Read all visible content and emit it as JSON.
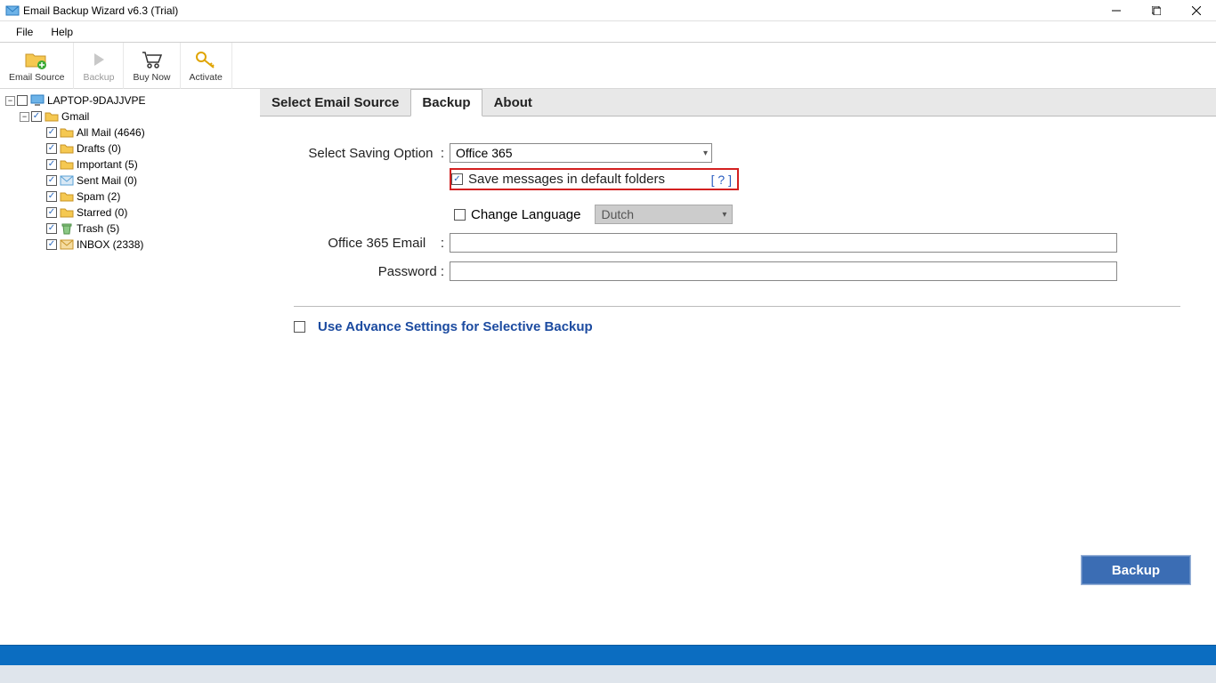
{
  "titlebar": {
    "text": "Email Backup Wizard v6.3 (Trial)"
  },
  "menubar": {
    "file": "File",
    "help": "Help"
  },
  "toolbar": {
    "email_source": "Email Source",
    "backup": "Backup",
    "buy_now": "Buy Now",
    "activate": "Activate"
  },
  "tree": {
    "root": "LAPTOP-9DAJJVPE",
    "gmail": "Gmail",
    "items": [
      "All Mail (4646)",
      "Drafts (0)",
      "Important (5)",
      "Sent Mail (0)",
      "Spam (2)",
      "Starred (0)",
      "Trash (5)",
      "INBOX (2338)"
    ]
  },
  "tabs": {
    "select_source": "Select Email Source",
    "backup": "Backup",
    "about": "About"
  },
  "form": {
    "saving_option_label": "Select Saving Option",
    "saving_option_value": "Office 365",
    "save_default_label": "Save messages in default folders",
    "help_link": "[ ? ]",
    "change_language_label": "Change Language",
    "language_value": "Dutch",
    "email_label": "Office 365 Email",
    "password_label": "Password",
    "advance_label": "Use Advance Settings for Selective Backup",
    "backup_button": "Backup"
  }
}
